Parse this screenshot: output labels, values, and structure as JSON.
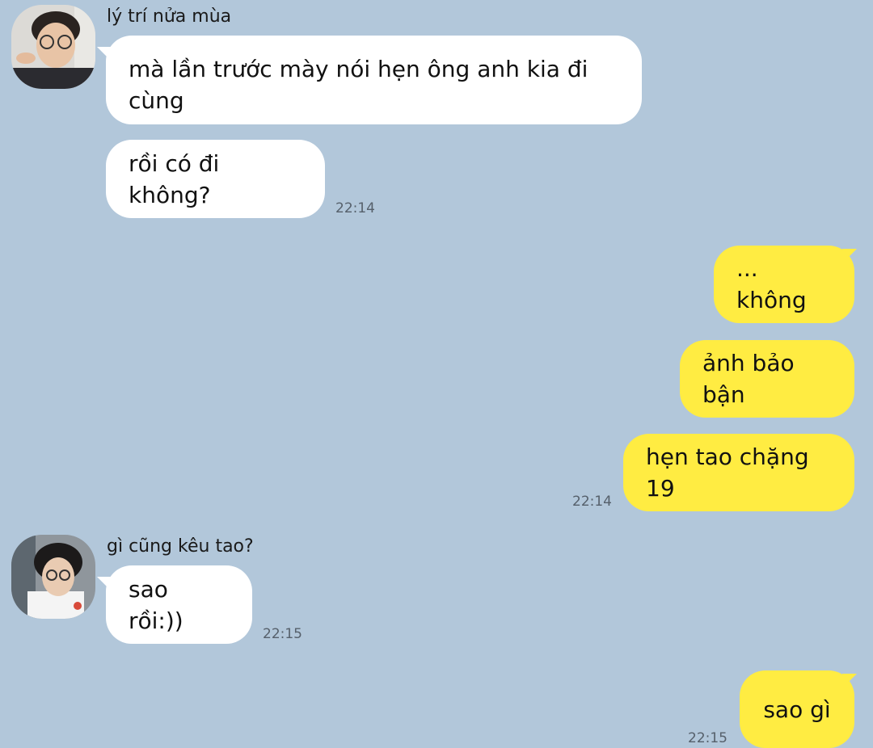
{
  "messages": [
    {
      "sender": "lý trí nửa mùa",
      "avatar": "friend-1-avatar",
      "bubbles": [
        "mà lần trước mày nói hẹn ông anh kia đi cùng",
        "rồi có đi không?"
      ],
      "time": "22:14",
      "outgoing": false
    },
    {
      "sender": "",
      "bubbles": [
        "... không",
        "ảnh bảo bận",
        "hẹn tao chặng 19"
      ],
      "time": "22:14",
      "outgoing": true
    },
    {
      "sender": "gì cũng kêu tao?",
      "avatar": "friend-2-avatar",
      "bubbles": [
        "sao rồi:))"
      ],
      "time": "22:15",
      "outgoing": false
    },
    {
      "sender": "",
      "bubbles": [
        "sao gì"
      ],
      "time": "22:15",
      "outgoing": true
    }
  ],
  "colors": {
    "background": "#b2c7da",
    "incoming_bubble": "#ffffff",
    "outgoing_bubble": "#ffec42"
  }
}
